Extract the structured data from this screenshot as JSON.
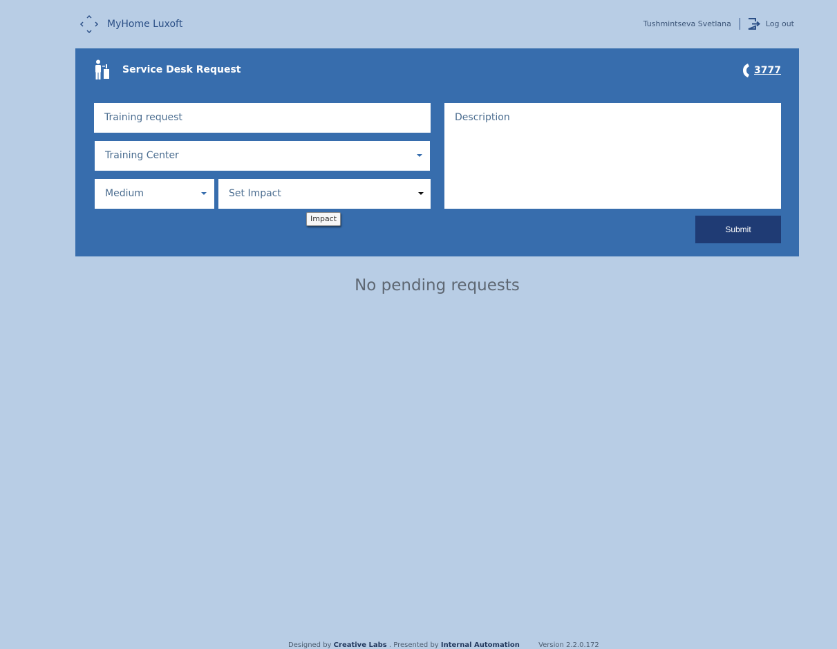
{
  "header": {
    "brand": "MyHome Luxoft",
    "user_name": "Tushmintseva Svetlana",
    "logout_label": "Log out"
  },
  "panel": {
    "title": "Service Desk Request",
    "phone": "3777",
    "subject_value": "Training request",
    "category_value": "Training Center",
    "priority_value": "Medium",
    "impact_value": "Set Impact",
    "description_placeholder": "Description",
    "tooltip": "Impact",
    "submit_label": "Submit"
  },
  "main": {
    "empty_message": "No pending requests"
  },
  "footer": {
    "designed_prefix": "Designed by",
    "designed_by": "Creative Labs",
    "presented_prefix": ". Presented by",
    "presented_by": "Internal Automation",
    "version": "Version 2.2.0.172"
  },
  "colors": {
    "background": "#b8cde5",
    "panel": "#376dad",
    "submit": "#1f3b74"
  },
  "icons": [
    "expand-logo-icon",
    "logout-icon",
    "service-desk-icon",
    "phone-icon",
    "caret-down-icon"
  ]
}
